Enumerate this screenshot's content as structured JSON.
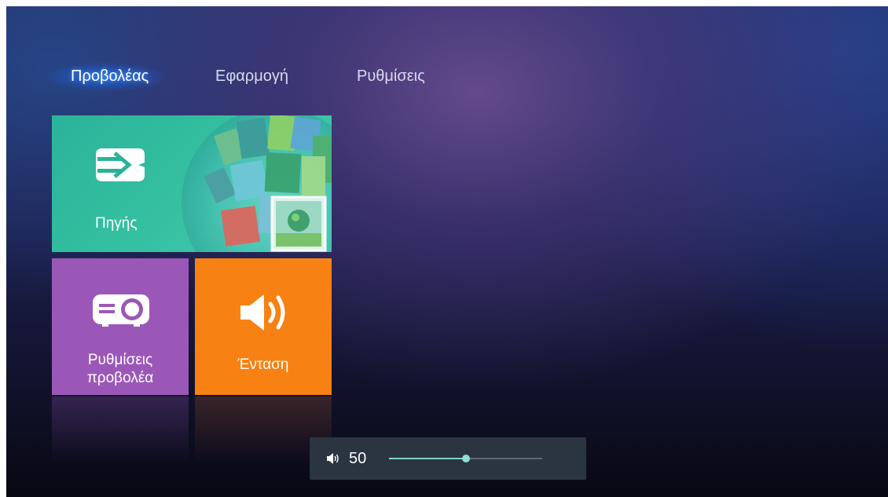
{
  "tabs": [
    {
      "label": "Προβολέας",
      "active": true
    },
    {
      "label": "Εφαρμογή",
      "active": false
    },
    {
      "label": "Ρυθμίσεις",
      "active": false
    }
  ],
  "tiles": {
    "source": {
      "label": "Πηγής",
      "icon": "input-source-icon",
      "color": "#2bb39a"
    },
    "projector": {
      "label_line1": "Ρυθμίσεις",
      "label_line2": "προβολέα",
      "icon": "projector-icon",
      "color": "#9b57b8"
    },
    "volume": {
      "label": "Ένταση",
      "icon": "speaker-icon",
      "color": "#f78112"
    }
  },
  "volume_osd": {
    "icon": "speaker-icon",
    "value": "50",
    "level": 0.5
  },
  "colors": {
    "accent": "#7fd3c4",
    "tab_glow": "#1e78ff"
  }
}
